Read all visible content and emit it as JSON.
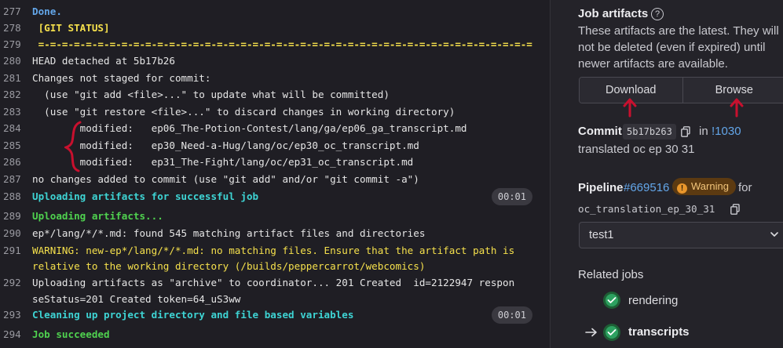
{
  "log": {
    "lines": [
      {
        "n": "277",
        "text": "Done.",
        "style": "blue bold"
      },
      {
        "n": "278",
        "text": " [GIT STATUS]",
        "style": "yellow bold"
      },
      {
        "n": "279",
        "text": " =-=-=-=-=-=-=-=-=-=-=-=-=-=-=-=-=-=-=-=-=-=-=-=-=-=-=-=-=-=-=-=-=-=-=-=-=-=-=-=-=-=",
        "style": "yellow bold"
      },
      {
        "n": "280",
        "text": "HEAD detached at 5b17b26",
        "style": ""
      },
      {
        "n": "281",
        "text": "Changes not staged for commit:",
        "style": ""
      },
      {
        "n": "282",
        "text": "  (use \"git add <file>...\" to update what will be committed)",
        "style": ""
      },
      {
        "n": "283",
        "text": "  (use \"git restore <file>...\" to discard changes in working directory)",
        "style": ""
      },
      {
        "n": "284",
        "text": "        modified:   ep06_The-Potion-Contest/lang/ga/ep06_ga_transcript.md",
        "style": ""
      },
      {
        "n": "285",
        "text": "        modified:   ep30_Need-a-Hug/lang/oc/ep30_oc_transcript.md",
        "style": ""
      },
      {
        "n": "286",
        "text": "        modified:   ep31_The-Fight/lang/oc/ep31_oc_transcript.md",
        "style": ""
      },
      {
        "n": "287",
        "text": "no changes added to commit (use \"git add\" and/or \"git commit -a\")",
        "style": ""
      },
      {
        "n": "288",
        "text": "Uploading artifacts for successful job",
        "style": "cyan bold",
        "duration": "00:01"
      },
      {
        "n": "289",
        "text": "Uploading artifacts...",
        "style": "green bold"
      },
      {
        "n": "290",
        "text": "ep*/lang/*/*.md: found 545 matching artifact files and directories",
        "style": ""
      },
      {
        "n": "291",
        "text": "WARNING: new-ep*/lang/*/*.md: no matching files. Ensure that the artifact path is",
        "style": "yellow"
      },
      {
        "n": "",
        "text": "relative to the working directory (/builds/peppercarrot/webcomics)",
        "style": "yellow"
      },
      {
        "n": "292",
        "text": "Uploading artifacts as \"archive\" to coordinator... 201 Created  id=2122947 respon",
        "style": ""
      },
      {
        "n": "",
        "text": "seStatus=201 Created token=64_uS3ww",
        "style": ""
      },
      {
        "n": "293",
        "text": "Cleaning up project directory and file based variables",
        "style": "cyan bold",
        "duration": "00:01"
      },
      {
        "n": "294",
        "text": "Job succeeded",
        "style": "green bold"
      }
    ]
  },
  "sidebar": {
    "artifacts_title": "Job artifacts",
    "artifacts_desc_1": "These artifacts are the latest. They will",
    "artifacts_desc_2": "not be deleted (even if expired) until",
    "artifacts_desc_3": "newer artifacts are available.",
    "download_label": "Download",
    "browse_label": "Browse",
    "commit_label": "Commit",
    "commit_sha": "5b17b263",
    "commit_in": "in",
    "commit_mr": "!1030",
    "commit_message": "translated oc ep 30 31",
    "pipeline_label": "Pipeline",
    "pipeline_id": "#669516",
    "pipeline_status": "Warning",
    "pipeline_for": "for",
    "pipeline_ref": "oc_translation_ep_30_31",
    "stage_selected": "test1",
    "related_jobs_title": "Related jobs",
    "jobs": [
      {
        "name": "rendering",
        "current": false
      },
      {
        "name": "transcripts",
        "current": true
      }
    ]
  },
  "colors": {
    "log_bg": "#1f1e24",
    "sidebar_bg": "#242329",
    "link": "#63a6e9",
    "annotation_red": "#c8102e",
    "success_green": "#2da160",
    "warning_orange": "#e9962b"
  },
  "icons": [
    "help-icon",
    "copy-icon",
    "warning-icon",
    "chevron-down-icon",
    "check-circle-icon",
    "arrow-right-icon"
  ]
}
